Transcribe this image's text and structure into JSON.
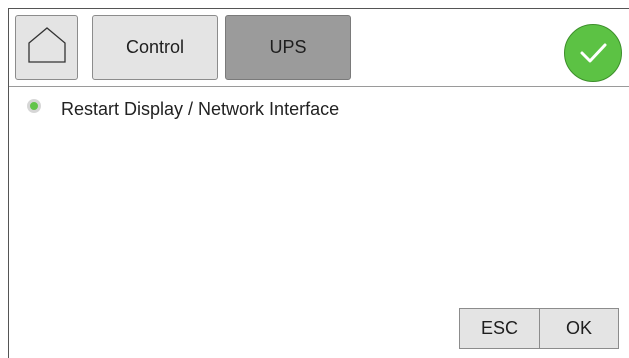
{
  "toolbar": {
    "home_icon": "home-icon",
    "control_label": "Control",
    "ups_label": "UPS",
    "status_icon": "checkmark-icon",
    "status_color": "#5cc244"
  },
  "main": {
    "option_label": "Restart Display / Network Interface",
    "option_selected": true
  },
  "footer": {
    "esc_label": "ESC",
    "ok_label": "OK"
  }
}
